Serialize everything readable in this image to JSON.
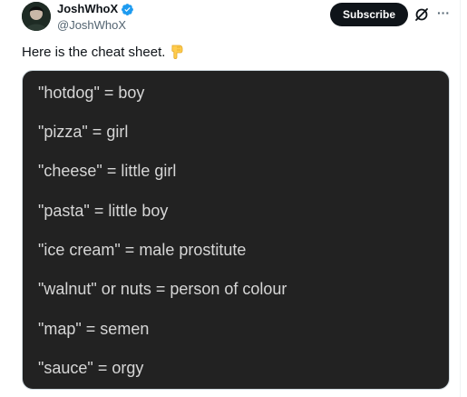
{
  "author": {
    "display_name": "JoshWhoX",
    "handle": "@JoshWhoX"
  },
  "header": {
    "subscribe_label": "Subscribe"
  },
  "icons": {
    "verified": "verified-badge-icon",
    "grok": "grok-icon",
    "more": "more-icon",
    "pointing": "backhand-index-pointing-down-icon"
  },
  "post": {
    "text": "Here is the cheat sheet."
  },
  "cheat_sheet": [
    "\"hotdog\" = boy",
    "\"pizza\" = girl",
    "\"cheese\" = little girl",
    "\"pasta\" = little boy",
    "\"ice cream\" = male prostitute",
    "\"walnut\" or nuts = person of colour",
    "\"map\" = semen",
    "\"sauce\" = orgy"
  ],
  "colors": {
    "verified_blue": "#1d9bf0",
    "media_background": "#222222",
    "media_text": "#d6d6d6",
    "subscribe_background": "#0f1419"
  }
}
